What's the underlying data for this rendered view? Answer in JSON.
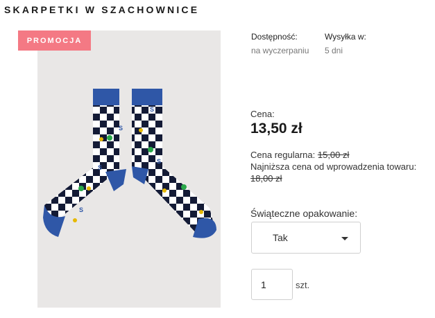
{
  "product": {
    "title": "SKARPETKI W SZACHOWNICE",
    "badge": "PROMOCJA"
  },
  "availability": {
    "label": "Dostępność:",
    "value": "na wyczerpaniu"
  },
  "shipping": {
    "label": "Wysyłka w:",
    "value": "5 dni"
  },
  "price": {
    "label": "Cena:",
    "value": "13,50 zł",
    "regular_label": "Cena regularna:",
    "regular_value": "15,00 zł",
    "lowest_label": "Najniższa cena od wprowadzenia towaru:",
    "lowest_value": "18,00 zł"
  },
  "gift_wrap": {
    "label": "Świąteczne opakowanie:",
    "selected": "Tak"
  },
  "quantity": {
    "value": "1",
    "unit": "szt."
  },
  "colors": {
    "badge": "#f47984",
    "sock_navy": "#141b36",
    "sock_blue": "#2f57a7",
    "sock_white": "#ffffff"
  },
  "icons": [
    "cursor-icon",
    "dollar-coin-icon",
    "trophy-icon",
    "s-letter-icon",
    "chevron-down-icon"
  ]
}
